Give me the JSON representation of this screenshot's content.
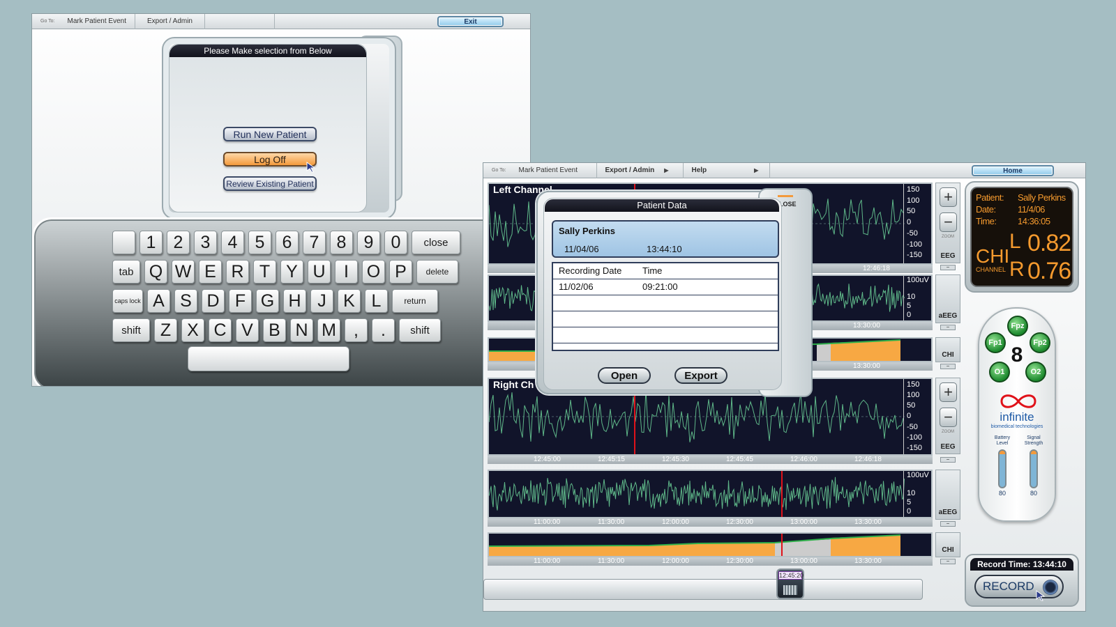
{
  "window1": {
    "menu": {
      "goto": "Go To:",
      "items": [
        "Mark Patient Event",
        "Export / Admin"
      ],
      "exit_label": "Exit"
    },
    "dialog": {
      "title": "Please Make selection from Below",
      "run_new_patient": "Run New Patient",
      "log_off": "Log Off",
      "review_existing": "Review Existing Patient"
    },
    "keyboard": {
      "row1": [
        "",
        "1",
        "2",
        "3",
        "4",
        "5",
        "6",
        "7",
        "8",
        "9",
        "0",
        "close"
      ],
      "row2": [
        "tab",
        "Q",
        "W",
        "E",
        "R",
        "T",
        "Y",
        "U",
        "I",
        "O",
        "P",
        "delete"
      ],
      "row3": [
        "caps lock",
        "A",
        "S",
        "D",
        "F",
        "G",
        "H",
        "J",
        "K",
        "L",
        "return"
      ],
      "row4": [
        "shift",
        "Z",
        "X",
        "C",
        "V",
        "B",
        "N",
        "M",
        ",",
        ".",
        "shift"
      ]
    }
  },
  "window2": {
    "menu": {
      "goto": "Go To:",
      "items": [
        "Mark Patient Event",
        "Export / Admin",
        "Help"
      ],
      "home_label": "Home"
    },
    "left_channel": {
      "label": "Left Channel",
      "eeg_scale": [
        "150",
        "100",
        "50",
        "0",
        "-50",
        "-100",
        "-150"
      ],
      "eeg_tag": "EEG",
      "eeg_time": "12:46:18",
      "aeeg_scale": [
        "100uV",
        "10",
        "5",
        "0"
      ],
      "aeeg_tag": "aEEG",
      "aeeg_time": "13:30:00",
      "chi_tag": "CHI",
      "chi_time": "13:30:00"
    },
    "right_channel": {
      "label": "Right Ch",
      "eeg_scale": [
        "150",
        "100",
        "50",
        "0",
        "-50",
        "-100",
        "-150"
      ],
      "eeg_tag": "EEG",
      "eeg_times": [
        "12:45:00",
        "12:45:15",
        "12:45:30",
        "12:45:45",
        "12:46:00",
        "12:46:18"
      ],
      "aeeg_scale": [
        "100uV",
        "10",
        "5",
        "0"
      ],
      "aeeg_tag": "aEEG",
      "aeeg_times": [
        "11:00:00",
        "11:30:00",
        "12:00:00",
        "12:30:00",
        "13:00:00",
        "13:30:00"
      ],
      "chi_tag": "CHI",
      "chi_times": [
        "11:00:00",
        "11:30:00",
        "12:00:00",
        "12:30:00",
        "13:00:00",
        "13:30:00"
      ]
    },
    "zoom_label": "ZOOM",
    "patient_dialog": {
      "title": "Patient Data",
      "close_label": "CLOSE",
      "selected": {
        "name": "Sally Perkins",
        "date": "11/04/06",
        "time": "13:44:10"
      },
      "table": {
        "headers": [
          "Recording Date",
          "Time"
        ],
        "rows": [
          [
            "11/02/06",
            "09:21:00"
          ]
        ]
      },
      "open_label": "Open",
      "export_label": "Export"
    },
    "info": {
      "patient_label": "Patient:",
      "patient": "Sally Perkins",
      "date_label": "Date:",
      "date": "11/4/06",
      "time_label": "Time:",
      "time": "14:36:05",
      "chi_label": "CHI",
      "channel_label": "CHANNEL",
      "l_label": "L",
      "l_value": "0.82",
      "r_label": "R",
      "r_value": "0.76"
    },
    "remote": {
      "electrodes": [
        "Fpz",
        "Fp1",
        "Fp2",
        "O1",
        "O2"
      ],
      "count": "8",
      "brand": "infinite",
      "brand_sub": "biomedical technologies",
      "battery_label": "Battery Level",
      "signal_label": "Signal Strength",
      "battery_value": "80",
      "signal_value": "80"
    },
    "record": {
      "time_label": "Record Time: 13:44:10",
      "button_label": "RECORD"
    },
    "scrubber_time": "12:45:20"
  },
  "colors": {
    "background": "#a5bec3",
    "trace": "#5fb889",
    "chi_fill": "#f7a843",
    "cursor": "#e0121a",
    "info_text": "#f59a2e"
  }
}
